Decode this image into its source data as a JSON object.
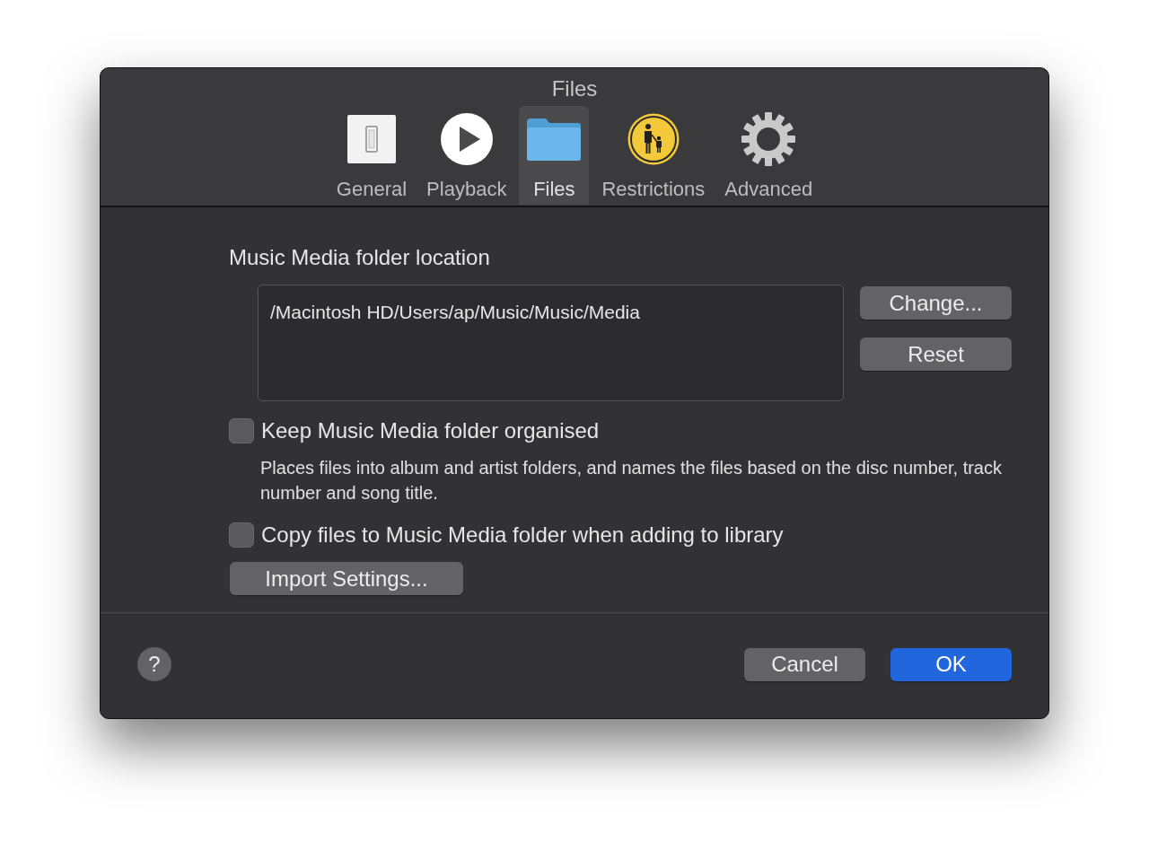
{
  "window": {
    "title": "Files"
  },
  "tabs": [
    {
      "label": "General",
      "kind": "switch",
      "selected": false
    },
    {
      "label": "Playback",
      "kind": "play",
      "selected": false
    },
    {
      "label": "Files",
      "kind": "folder",
      "selected": true
    },
    {
      "label": "Restrictions",
      "kind": "parental",
      "selected": false
    },
    {
      "label": "Advanced",
      "kind": "gear",
      "selected": false
    }
  ],
  "location": {
    "label": "Music Media folder location",
    "path": "/Macintosh HD/Users/ap/Music/Music/Media",
    "buttons": [
      "Change...",
      "Reset"
    ]
  },
  "options": [
    {
      "label": "Keep Music Media folder organised",
      "checked": false,
      "description": "Places files into album and artist folders, and names the files based on the disc number, track number and song title."
    },
    {
      "label": "Copy files to Music Media folder when adding to library",
      "checked": false
    }
  ],
  "import_button": "Import Settings...",
  "footer": {
    "help": "?",
    "cancel": "Cancel",
    "ok": "OK"
  }
}
